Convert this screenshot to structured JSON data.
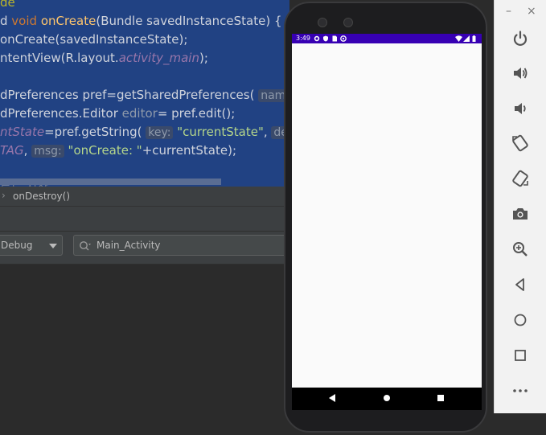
{
  "editor": {
    "lines": [
      {
        "segments": [
          {
            "t": "de",
            "c": "ann"
          }
        ]
      },
      {
        "segments": [
          {
            "t": "d ",
            "c": ""
          },
          {
            "t": "void ",
            "c": "kw"
          },
          {
            "t": "onCreate",
            "c": "fn"
          },
          {
            "t": "(Bundle savedInstanceState) {",
            "c": ""
          }
        ]
      },
      {
        "segments": [
          {
            "t": "onCreate(savedInstanceState);",
            "c": ""
          }
        ]
      },
      {
        "segments": [
          {
            "t": "ntentView(R.layout.",
            "c": ""
          },
          {
            "t": "activity_main",
            "c": "it"
          },
          {
            "t": ");",
            "c": ""
          }
        ]
      },
      {
        "segments": [
          {
            "t": "",
            "c": ""
          }
        ]
      },
      {
        "segments": [
          {
            "t": "dPreferences pref=getSharedPreferences( ",
            "c": ""
          },
          {
            "t": "name",
            "c": "hint"
          }
        ]
      },
      {
        "segments": [
          {
            "t": "dPreferences.Editor ",
            "c": ""
          },
          {
            "t": "editor",
            "c": "dim"
          },
          {
            "t": "= pref.edit();",
            "c": ""
          }
        ]
      },
      {
        "segments": [
          {
            "t": "ntState",
            "c": "it"
          },
          {
            "t": "=pref.getString( ",
            "c": ""
          },
          {
            "t": "key:",
            "c": "hint"
          },
          {
            "t": " ",
            "c": ""
          },
          {
            "t": "\"currentState\"",
            "c": "str2"
          },
          {
            "t": ", ",
            "c": ""
          },
          {
            "t": "defV",
            "c": "hint"
          }
        ]
      },
      {
        "segments": [
          {
            "t": "TAG",
            "c": "it"
          },
          {
            "t": ", ",
            "c": ""
          },
          {
            "t": "msg:",
            "c": "hint"
          },
          {
            "t": " ",
            "c": ""
          },
          {
            "t": "\"onCreate: \"",
            "c": "str2"
          },
          {
            "t": "+currentState);",
            "c": ""
          }
        ]
      },
      {
        "segments": [
          {
            "t": "",
            "c": ""
          }
        ]
      },
      {
        "segments": [
          {
            "t": "르드 시작",
            "c": "dimk"
          }
        ]
      }
    ]
  },
  "breadcrumb": {
    "item": "onDestroy()"
  },
  "logcat": {
    "level_value": "Debug",
    "search_value": "Main_Activity"
  },
  "emulator": {
    "window": {
      "minimize": "–",
      "close": "×"
    },
    "toolbar": [
      "power",
      "volume-up",
      "volume-down",
      "rotate-left",
      "rotate-right",
      "screenshot",
      "zoom",
      "back",
      "home",
      "overview",
      "more"
    ]
  },
  "phone": {
    "status": {
      "time": "3:49"
    },
    "colors": {
      "status_bar": "#3700b3",
      "screen": "#fafafa",
      "nav": "#000000"
    }
  }
}
